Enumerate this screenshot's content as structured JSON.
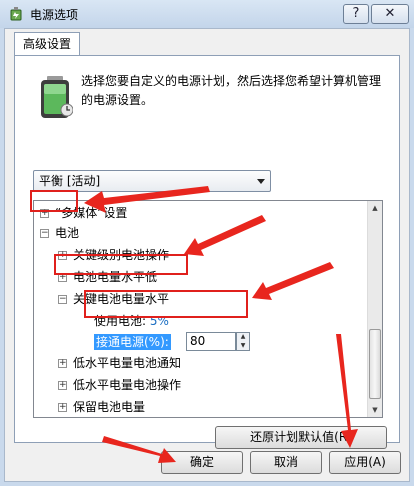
{
  "window": {
    "title": "电源选项",
    "help_label": "?",
    "close_label": "✕"
  },
  "tab": {
    "label": "高级设置"
  },
  "description": "选择您要自定义的电源计划，然后选择您希望计算机管理的电源设置。",
  "plan_select": {
    "value": "平衡 [活动]"
  },
  "tree": {
    "items": [
      {
        "label": "“多媒体”设置",
        "expander": "+"
      },
      {
        "label": "电池",
        "expander": "−"
      },
      {
        "label": "关键级别电池操作",
        "expander": "+"
      },
      {
        "label": "电池电量水平低",
        "expander": "+"
      },
      {
        "label": "关键电池电量水平",
        "expander": "−"
      },
      {
        "label": "低水平电量电池通知",
        "expander": "+"
      },
      {
        "label": "低水平电量电池操作",
        "expander": "+"
      },
      {
        "label": "保留电池电量",
        "expander": "+"
      }
    ],
    "on_battery": {
      "label": "使用电池:",
      "value": "5%"
    },
    "plugged_in": {
      "label": "接通电源(%):",
      "value": "80"
    }
  },
  "buttons": {
    "restore": "还原计划默认值(R)",
    "ok": "确定",
    "cancel": "取消",
    "apply": "应用(A)"
  },
  "colors": {
    "annotation": "#e0201c",
    "highlight": "#3399ff"
  }
}
